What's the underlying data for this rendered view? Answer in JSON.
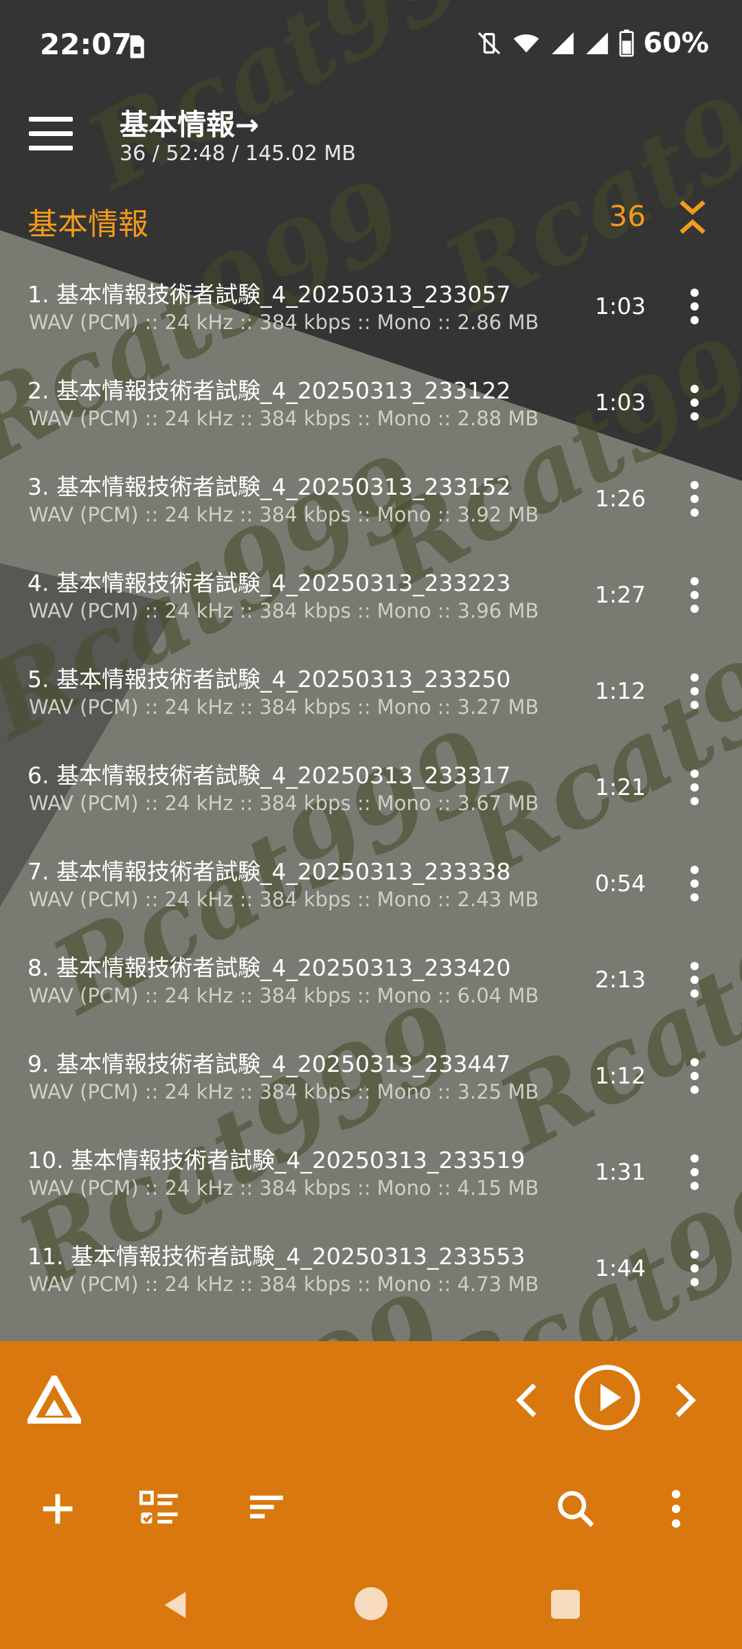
{
  "status_bar": {
    "time": "22:07",
    "battery": "60%",
    "icons": [
      "sim-card-icon",
      "vibrate-off-icon",
      "wifi-icon",
      "signal-icon",
      "signal-icon",
      "battery-icon"
    ]
  },
  "app_bar": {
    "title": "基本情報→",
    "subtitle": "36 / 52:48 / 145.02 MB"
  },
  "section": {
    "title": "基本情報",
    "count": "36"
  },
  "tracks": [
    {
      "title": "1. 基本情報技術者試験_4_20250313_233057",
      "meta": "WAV (PCM) :: 24 kHz :: 384 kbps :: Mono :: 2.86 MB",
      "duration": "1:03"
    },
    {
      "title": "2. 基本情報技術者試験_4_20250313_233122",
      "meta": "WAV (PCM) :: 24 kHz :: 384 kbps :: Mono :: 2.88 MB",
      "duration": "1:03"
    },
    {
      "title": "3. 基本情報技術者試験_4_20250313_233152",
      "meta": "WAV (PCM) :: 24 kHz :: 384 kbps :: Mono :: 3.92 MB",
      "duration": "1:26"
    },
    {
      "title": "4. 基本情報技術者試験_4_20250313_233223",
      "meta": "WAV (PCM) :: 24 kHz :: 384 kbps :: Mono :: 3.96 MB",
      "duration": "1:27"
    },
    {
      "title": "5. 基本情報技術者試験_4_20250313_233250",
      "meta": "WAV (PCM) :: 24 kHz :: 384 kbps :: Mono :: 3.27 MB",
      "duration": "1:12"
    },
    {
      "title": "6. 基本情報技術者試験_4_20250313_233317",
      "meta": "WAV (PCM) :: 24 kHz :: 384 kbps :: Mono :: 3.67 MB",
      "duration": "1:21"
    },
    {
      "title": "7. 基本情報技術者試験_4_20250313_233338",
      "meta": "WAV (PCM) :: 24 kHz :: 384 kbps :: Mono :: 2.43 MB",
      "duration": "0:54"
    },
    {
      "title": "8. 基本情報技術者試験_4_20250313_233420",
      "meta": "WAV (PCM) :: 24 kHz :: 384 kbps :: Mono :: 6.04 MB",
      "duration": "2:13"
    },
    {
      "title": "9. 基本情報技術者試験_4_20250313_233447",
      "meta": "WAV (PCM) :: 24 kHz :: 384 kbps :: Mono :: 3.25 MB",
      "duration": "1:12"
    },
    {
      "title": "10. 基本情報技術者試験_4_20250313_233519",
      "meta": "WAV (PCM) :: 24 kHz :: 384 kbps :: Mono :: 4.15 MB",
      "duration": "1:31"
    },
    {
      "title": "11. 基本情報技術者試験_4_20250313_233553",
      "meta": "WAV (PCM) :: 24 kHz :: 384 kbps :: Mono :: 4.73 MB",
      "duration": "1:44"
    }
  ],
  "watermark": {
    "text": "Rcat999"
  },
  "colors": {
    "accent": "#f39a1b",
    "player_bg": "#d9780e",
    "dark_bg": "#343434",
    "grey_bg": "#7a7a72"
  },
  "player_icons": [
    "app-logo-icon",
    "previous-icon",
    "play-icon",
    "next-icon"
  ],
  "toolbar_icons": [
    "add-icon",
    "checklist-icon",
    "sort-icon",
    "search-icon",
    "more-vert-icon"
  ],
  "nav_icons": [
    "back-icon",
    "home-icon",
    "recents-icon"
  ]
}
